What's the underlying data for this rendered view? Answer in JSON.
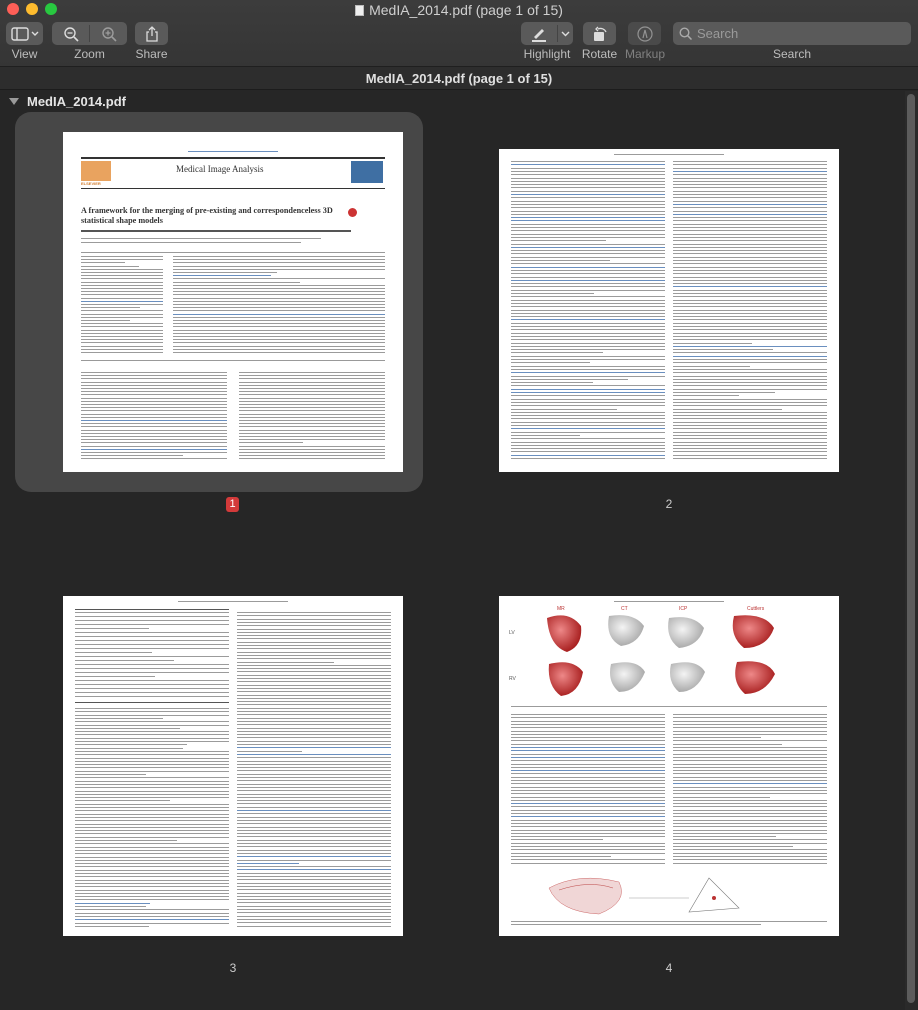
{
  "window": {
    "title": "MedIA_2014.pdf (page 1 of 15)",
    "doc_title": "MedIA_2014.pdf (page 1 of 15)"
  },
  "toolbar": {
    "view_label": "View",
    "zoom_label": "Zoom",
    "share_label": "Share",
    "highlight_label": "Highlight",
    "rotate_label": "Rotate",
    "markup_label": "Markup",
    "search_label": "Search",
    "search_placeholder": "Search"
  },
  "sidebar": {
    "file_name": "MedIA_2014.pdf"
  },
  "pages": [
    {
      "number": "1",
      "selected": true
    },
    {
      "number": "2",
      "selected": false
    },
    {
      "number": "3",
      "selected": false
    },
    {
      "number": "4",
      "selected": false
    }
  ],
  "page1": {
    "journal_name": "Medical Image Analysis",
    "paper_title": "A framework for the merging of pre-existing and correspondenceless 3D statistical shape models",
    "publisher": "ELSEVIER"
  },
  "page4": {
    "fig_labels": [
      "MR",
      "CT",
      "ICP",
      "Cuttlers"
    ],
    "row_labels": [
      "LV",
      "RV"
    ]
  }
}
